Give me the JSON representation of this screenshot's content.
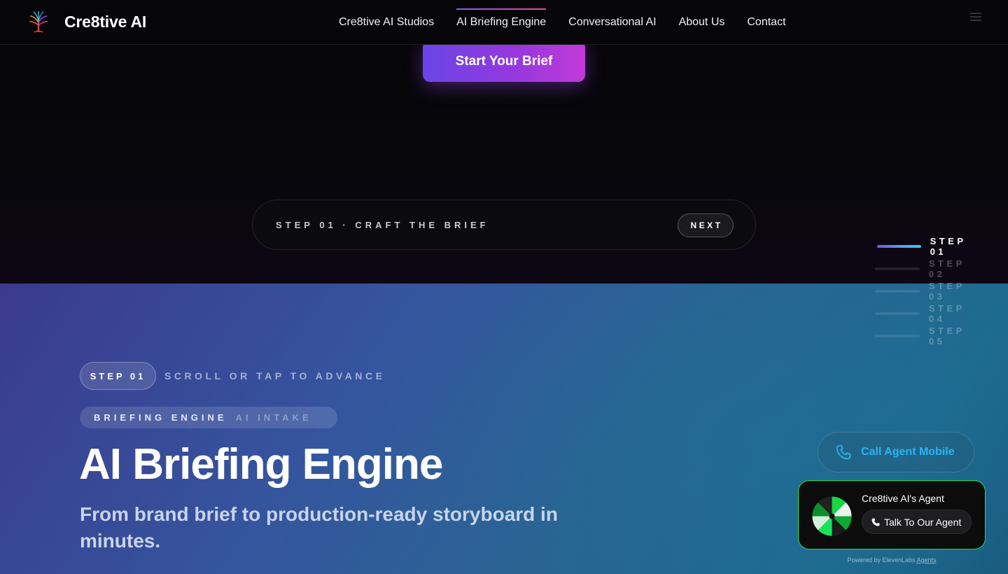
{
  "nav": {
    "brand": "Cre8tive AI",
    "links": [
      "Cre8tive AI Studios",
      "AI Briefing Engine",
      "Conversational AI",
      "About Us",
      "Contact"
    ],
    "active_index": 1
  },
  "cta": {
    "label": "Start Your Brief"
  },
  "stepbar": {
    "text": "STEP 01 · CRAFT THE BRIEF",
    "next_label": "NEXT"
  },
  "step_rail": {
    "items": [
      "STEP 01",
      "STEP 02",
      "STEP 03",
      "STEP 04",
      "STEP 05"
    ],
    "active_index": 0
  },
  "hero": {
    "step_chip": "STEP 01",
    "scroll_hint": "SCROLL OR TAP TO ADVANCE",
    "eyebrow_primary": "BRIEFING ENGINE",
    "eyebrow_secondary": "AI INTAKE",
    "headline": "AI Briefing Engine",
    "subhead": "From brand brief to production-ready storyboard in minutes."
  },
  "call_agent": {
    "label": "Call Agent Mobile"
  },
  "agent_widget": {
    "title": "Cre8tive AI's Agent",
    "button_label": "Talk To Our Agent",
    "powered_prefix": "Powered by ElevenLabs",
    "powered_link": "Agents",
    "border_color": "#19e35a"
  },
  "colors": {
    "accent_purple": "#8a5cf6",
    "accent_pink": "#e04a9a",
    "call_blue": "#28b6f2"
  }
}
